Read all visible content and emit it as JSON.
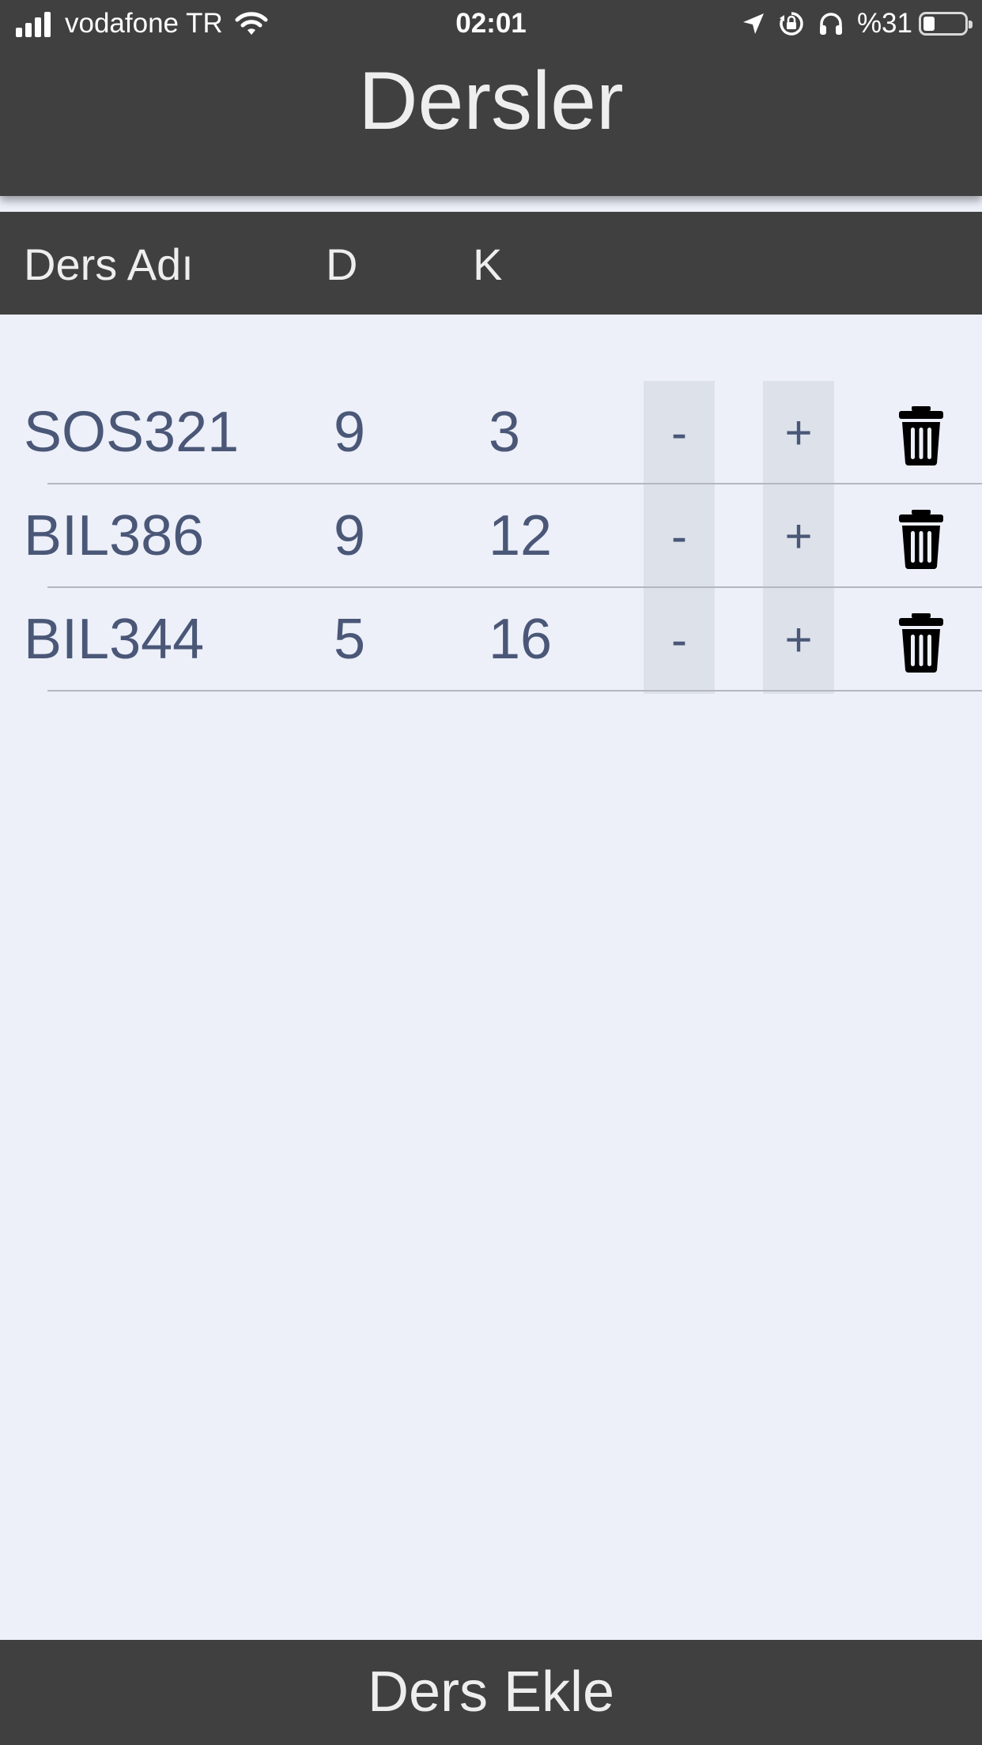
{
  "status_bar": {
    "carrier": "vodafone TR",
    "time": "02:01",
    "battery": "%31",
    "battery_level": 0.31,
    "icons": [
      "signal-icon",
      "wifi-icon",
      "location-arrow-icon",
      "rotation-lock-icon",
      "headphones-icon",
      "battery-icon"
    ]
  },
  "header": {
    "title": "Dersler"
  },
  "table": {
    "columns": {
      "name": "Ders Adı",
      "d": "D",
      "k": "K"
    },
    "rows": [
      {
        "name": "SOS321",
        "d": "9",
        "k": "3",
        "minus": "-",
        "plus": "+",
        "delete_icon": "trash-icon"
      },
      {
        "name": "BIL386",
        "d": "9",
        "k": "12",
        "minus": "-",
        "plus": "+",
        "delete_icon": "trash-icon"
      },
      {
        "name": "BIL344",
        "d": "5",
        "k": "16",
        "minus": "-",
        "plus": "+",
        "delete_icon": "trash-icon"
      }
    ]
  },
  "footer": {
    "add_button": "Ders Ekle"
  },
  "colors": {
    "bar_background": "#404040",
    "page_background": "#edf0f9",
    "text_primary": "#4a5777",
    "button_column": "#dde1ea"
  }
}
